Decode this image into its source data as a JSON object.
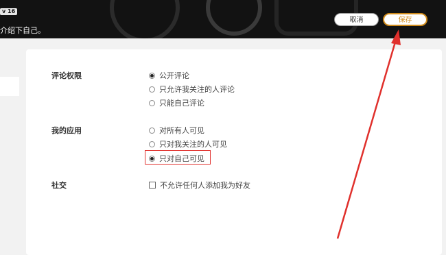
{
  "header": {
    "level_badge": "v 16",
    "bio": "介绍下自己。",
    "cancel_label": "取消",
    "save_label": "保存"
  },
  "settings": {
    "comment_permission": {
      "label": "评论权限",
      "options": [
        "公开评论",
        "只允许我关注的人评论",
        "只能自己评论"
      ],
      "selected": 0
    },
    "my_apps": {
      "label": "我的应用",
      "options": [
        "对所有人可见",
        "只对我关注的人可见",
        "只对自己可见"
      ],
      "selected": 2
    },
    "social": {
      "label": "社交",
      "checkbox_label": "不允许任何人添加我为好友",
      "checked": false
    }
  },
  "colors": {
    "header_bg": "#121212",
    "save_accent": "#d08b1b",
    "annotation_red": "#e0302c"
  }
}
